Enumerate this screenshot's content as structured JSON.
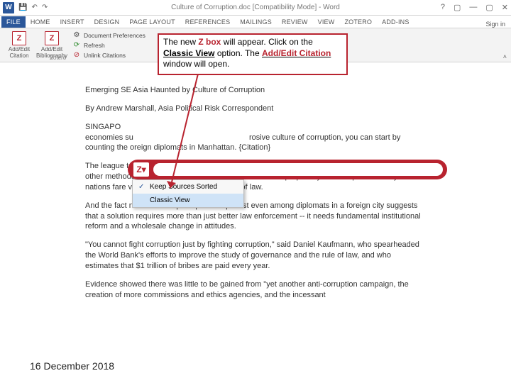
{
  "titlebar": {
    "title": "Culture of Corruption.doc [Compatibility Mode] - Word",
    "qat_save": "💾",
    "qat_undo": "↶",
    "qat_redo": "↷",
    "help": "?",
    "restore": "▢",
    "min": "—",
    "close": "✕"
  },
  "tabs": {
    "file": "FILE",
    "home": "HOME",
    "insert": "INSERT",
    "design": "DESIGN",
    "pagelayout": "PAGE LAYOUT",
    "references": "REFERENCES",
    "mailings": "MAILINGS",
    "review": "REVIEW",
    "view": "VIEW",
    "zotero": "ZOTERO",
    "addins": "ADD-INS",
    "signin": "Sign in"
  },
  "ribbon": {
    "addedit_citation_l1": "Add/Edit",
    "addedit_citation_l2": "Citation",
    "addedit_bib_l1": "Add/Edit",
    "addedit_bib_l2": "Bibliography",
    "docprefs": "Document Preferences",
    "refresh": "Refresh",
    "unlink": "Unlink Citations",
    "group": "Zotero",
    "caret": "˄"
  },
  "callout": {
    "p1a": "The new ",
    "p1b": "Z box",
    "p1c": " will appear. Click on the ",
    "p1d": "Classic View",
    "p1e": " option. The ",
    "p1f": "Add/Edit Citation",
    "p1g": " window will open."
  },
  "doc": {
    "l1": "Emerging SE Asia Haunted by Culture of Corruption",
    "l2": "By Andrew Marshall, Asia Political Risk Correspondent",
    "l3a": "SINGAPO",
    "l3b": "economies su",
    "l3c": "rosive culture of corruption, you can start by counting the",
    "l3d": "oreign diplomats in Manhattan. {Citation}",
    "l4": "The league table of the worst parking offenders in New York embassies tells the same story as other methods economists have used to gauge countries' propensity for corruption -- many Asian nations fare very poorly in upholding the rule of law.",
    "l5": "And the fact national corruption patterns persist even among diplomats in a foreign city suggests that a solution requires more than just better law enforcement -- it needs fundamental institutional reform and a wholesale change in attitudes.",
    "l6": "\"You cannot fight corruption just by fighting corruption,\" said Daniel Kaufmann, who spearheaded the World Bank's efforts to improve the study of governance and the rule of law, and who estimates that $1 trillion of bribes are paid every year.",
    "l7": "Evidence showed there was little to be gained from \"yet another anti-corruption campaign, the creation of more commissions and ethics agencies, and the incessant"
  },
  "zbar": {
    "z": "Z▾"
  },
  "dropdown": {
    "keep": "Keep Sources Sorted",
    "classic": "Classic View"
  },
  "footer": {
    "date": "16 December 2018"
  }
}
